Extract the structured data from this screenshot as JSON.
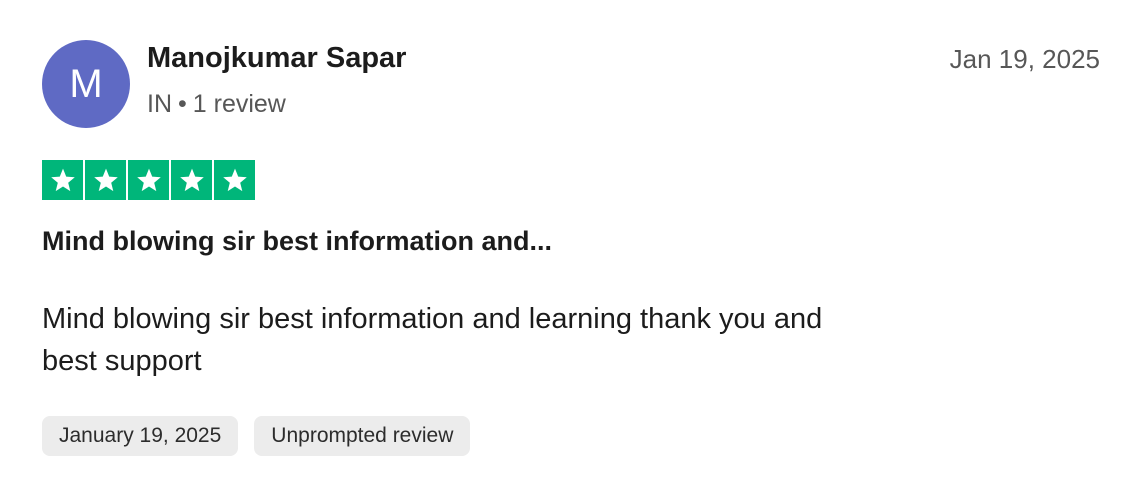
{
  "reviewer": {
    "avatar_initial": "M",
    "avatar_color": "#5f6ac4",
    "name": "Manojkumar Sapar",
    "country": "IN",
    "separator": "•",
    "review_count": "1 review"
  },
  "review": {
    "date_short": "Jan 19, 2025",
    "rating": 5,
    "rating_max": 5,
    "star_color": "#00b67a",
    "title": "Mind blowing sir best information and...",
    "body_line1": "Mind blowing sir best information and learning thank you and",
    "body_line2": "best support"
  },
  "tags": {
    "date_full": "January 19, 2025",
    "unprompted": "Unprompted review"
  }
}
